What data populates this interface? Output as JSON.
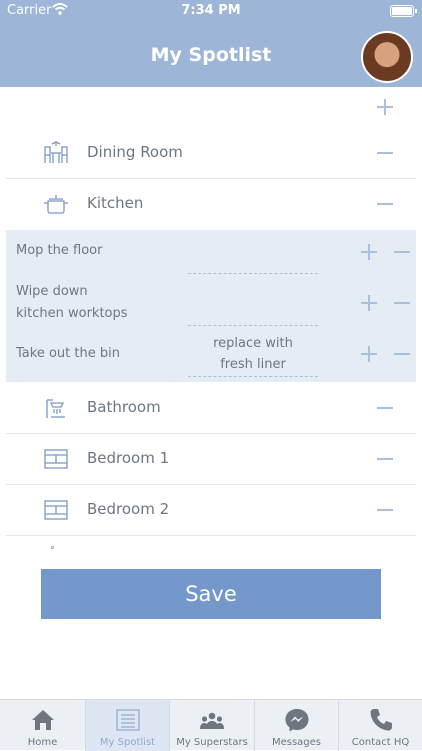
{
  "status_bar": {
    "carrier": "Carrier",
    "time": "7:34 PM"
  },
  "header": {
    "title": "My Spotlist"
  },
  "rooms_top": [
    {
      "label": "Dining Room",
      "icon": "dining-table-icon"
    },
    {
      "label": "Kitchen",
      "icon": "cooking-pot-icon"
    }
  ],
  "tasks": [
    {
      "label_line1": "Mop the floor",
      "label_line2": "",
      "note_line1": "",
      "note_line2": ""
    },
    {
      "label_line1": "Wipe down",
      "label_line2": "kitchen worktops",
      "note_line1": "",
      "note_line2": ""
    },
    {
      "label_line1": "Take out the bin",
      "label_line2": "",
      "note_line1": "replace with",
      "note_line2": "fresh liner"
    }
  ],
  "rooms_bottom": [
    {
      "label": "Bathroom",
      "icon": "shower-icon"
    },
    {
      "label": "Bedroom 1",
      "icon": "bed-icon"
    },
    {
      "label": "Bedroom 2",
      "icon": "bed-icon"
    }
  ],
  "save_label": "Save",
  "tabs": [
    {
      "label": "Home",
      "icon": "home-icon",
      "active": false
    },
    {
      "label": "My Spotlist",
      "icon": "list-icon",
      "active": true
    },
    {
      "label": "My Superstars",
      "icon": "people-icon",
      "active": false
    },
    {
      "label": "Messages",
      "icon": "messenger-icon",
      "active": false
    },
    {
      "label": "Contact HQ",
      "icon": "phone-icon",
      "active": false
    }
  ],
  "colors": {
    "header": "#9db5d6",
    "accent": "#7498cc",
    "task_bg": "#e6ecf4",
    "control": "#a8bfdf"
  }
}
